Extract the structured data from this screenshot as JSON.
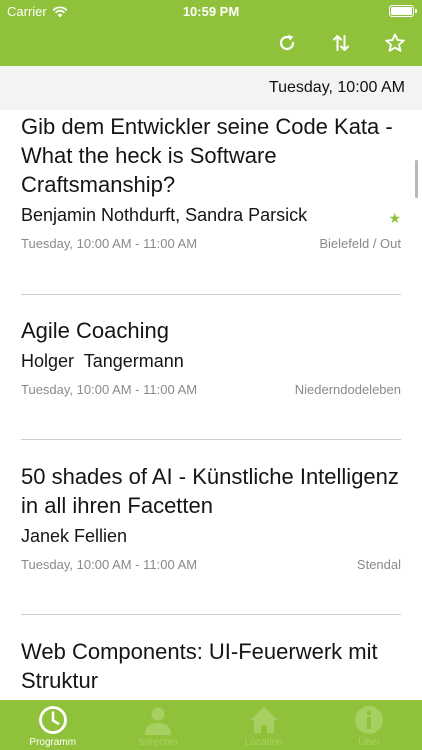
{
  "status_bar": {
    "carrier": "Carrier",
    "time": "10:59 PM"
  },
  "nav": {
    "icons": [
      "refresh-icon",
      "sort-icon",
      "favorites-star-icon"
    ]
  },
  "date_header": "Tuesday, 10:00 AM",
  "sessions": [
    {
      "title": "Gib dem Entwickler seine Code Kata - What the heck is Software Craftsmanship?",
      "speakers": "Benjamin Nothdurft, Sandra Parsick",
      "time": "Tuesday, 10:00 AM - 11:00 AM",
      "location": "Bielefeld / Out",
      "favorite": true
    },
    {
      "title": "Agile Coaching",
      "speakers": "Holger  Tangermann",
      "time": "Tuesday, 10:00 AM - 11:00 AM",
      "location": "Niederndodeleben",
      "favorite": false
    },
    {
      "title": "50 shades of AI - Künstliche Intelligenz in all ihren Facetten",
      "speakers": "Janek Fellien",
      "time": "Tuesday, 10:00 AM - 11:00 AM",
      "location": "Stendal",
      "favorite": false
    },
    {
      "title": "Web Components: UI-Feuerwerk mit Struktur",
      "speakers": "",
      "time": "",
      "location": "",
      "favorite": false
    }
  ],
  "tabs": [
    {
      "label": "Programm",
      "icon": "clock-icon",
      "active": true
    },
    {
      "label": "Sprecher",
      "icon": "person-icon",
      "active": false
    },
    {
      "label": "Location",
      "icon": "home-icon",
      "active": false
    },
    {
      "label": "Über",
      "icon": "info-icon",
      "active": false
    }
  ],
  "colors": {
    "accent": "#8fc23a",
    "tab_inactive": "#a7cf62",
    "header_bg": "#f3f3f3",
    "meta_text": "#8a8a8a"
  }
}
